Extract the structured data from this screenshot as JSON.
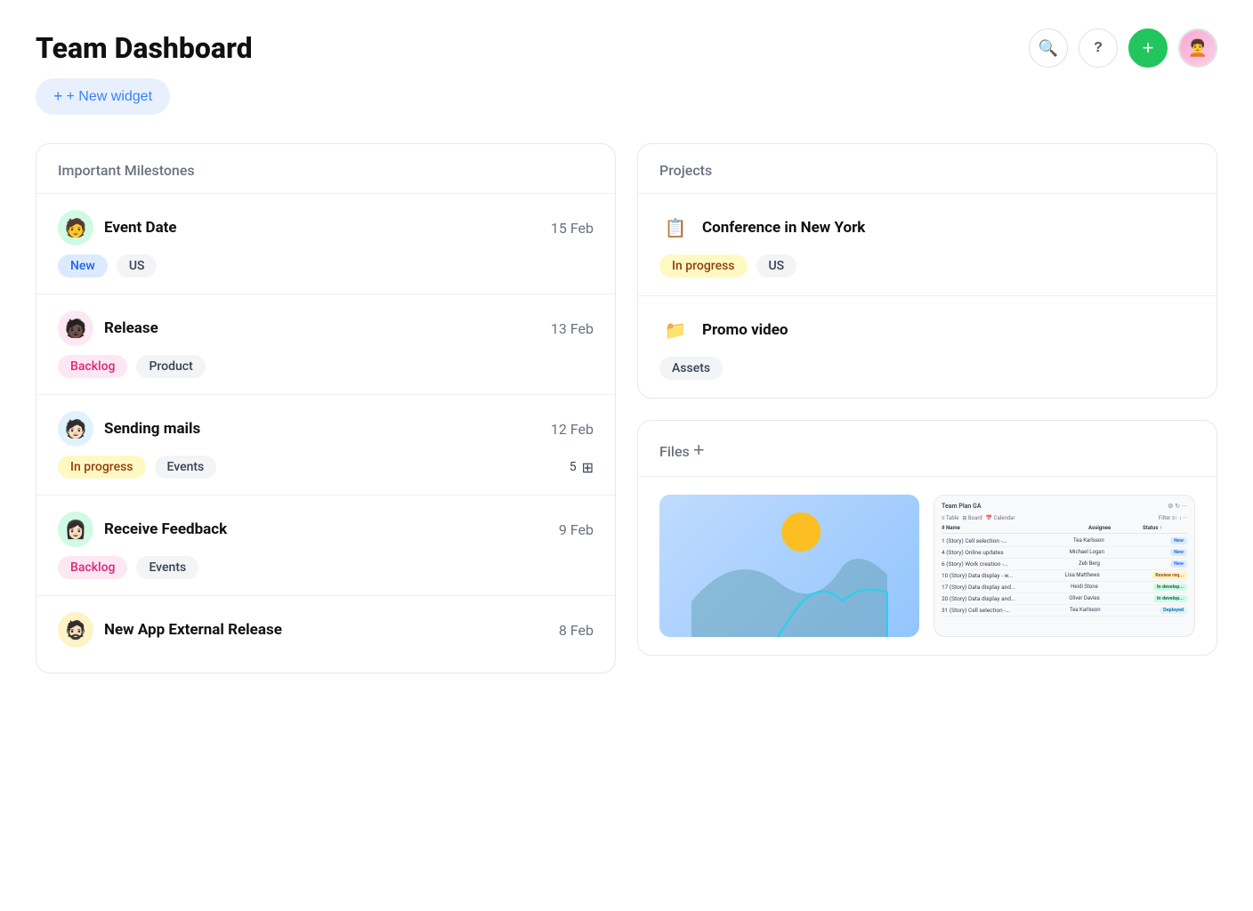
{
  "header": {
    "title": "Team Dashboard",
    "new_widget_label": "+ New widget",
    "search_icon": "🔍",
    "help_icon": "?",
    "add_icon": "+"
  },
  "milestones": {
    "section_title": "Important Milestones",
    "items": [
      {
        "id": 1,
        "name": "Event Date",
        "date": "15 Feb",
        "tags": [
          "New",
          "US"
        ],
        "tag_styles": [
          "tag-new",
          "tag-us"
        ],
        "avatar_bg": "#d1fae5",
        "avatar_emoji": "👤"
      },
      {
        "id": 2,
        "name": "Release",
        "date": "13 Feb",
        "tags": [
          "Backlog",
          "Product"
        ],
        "tag_styles": [
          "tag-backlog",
          "tag-product"
        ],
        "avatar_bg": "#fce7f3",
        "avatar_emoji": "👤"
      },
      {
        "id": 3,
        "name": "Sending mails",
        "date": "12 Feb",
        "tags": [
          "In progress",
          "Events"
        ],
        "tag_styles": [
          "tag-inprogress",
          "tag-events"
        ],
        "avatar_bg": "#e0f2fe",
        "avatar_emoji": "👤",
        "count": "5",
        "has_count": true
      },
      {
        "id": 4,
        "name": "Receive Feedback",
        "date": "9 Feb",
        "tags": [
          "Backlog",
          "Events"
        ],
        "tag_styles": [
          "tag-backlog",
          "tag-events"
        ],
        "avatar_bg": "#d1fae5",
        "avatar_emoji": "👤"
      },
      {
        "id": 5,
        "name": "New App External Release",
        "date": "8 Feb",
        "tags": [],
        "tag_styles": [],
        "avatar_bg": "#fef3c7",
        "avatar_emoji": "👤"
      }
    ]
  },
  "projects": {
    "section_title": "Projects",
    "items": [
      {
        "id": 1,
        "name": "Conference in New York",
        "icon": "📋",
        "tags": [
          "In progress",
          "US"
        ],
        "tag_styles": [
          "tag-inprogress",
          "tag-us"
        ]
      },
      {
        "id": 2,
        "name": "Promo video",
        "icon": "📁",
        "tags": [
          "Assets"
        ],
        "tag_styles": [
          "tag-assets"
        ]
      }
    ]
  },
  "files": {
    "section_title": "Files",
    "add_label": "+",
    "file1_name": "Team Plan GA",
    "table_rows": [
      {
        "name": "(Story) Cell selection -...",
        "assignee": "Tea Karlsson",
        "status": "New",
        "status_style": "mini-new"
      },
      {
        "name": "(Story) Online updates",
        "assignee": "Michael Logan",
        "status": "New",
        "status_style": "mini-new"
      },
      {
        "name": "(Story) Work creation -...",
        "assignee": "Zeb Berg",
        "status": "New",
        "status_style": "mini-new"
      },
      {
        "name": "(Story) Data display - w...",
        "assignee": "Lisa Matthews",
        "status": "Review required",
        "status_style": "mini-review"
      },
      {
        "name": "(Story) Data display and...",
        "assignee": "Heidi Stone",
        "status": "In development",
        "status_style": "mini-dev"
      },
      {
        "name": "(Story) Data display and...",
        "assignee": "Oliver Davies",
        "status": "In development",
        "status_style": "mini-dev"
      },
      {
        "name": "(Story) Cell selection -...",
        "assignee": "Tea Karlsson",
        "status": "Deployed",
        "status_style": "mini-deployed"
      }
    ]
  }
}
